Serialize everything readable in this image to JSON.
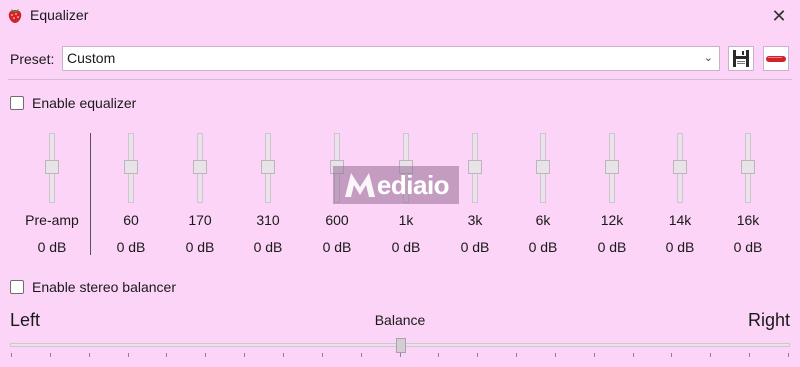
{
  "window": {
    "title": "Equalizer",
    "app_icon": "strawberry-icon",
    "close_icon": "close-icon"
  },
  "preset": {
    "label": "Preset:",
    "selected": "Custom",
    "save_icon": "floppy-disk-icon",
    "delete_icon": "delete-bar-icon"
  },
  "equalizer": {
    "enable_label": "Enable equalizer",
    "enabled": false,
    "bands": [
      {
        "label": "Pre-amp",
        "value": "0 dB",
        "level": 0
      },
      {
        "label": "60",
        "value": "0 dB",
        "level": 0
      },
      {
        "label": "170",
        "value": "0 dB",
        "level": 0
      },
      {
        "label": "310",
        "value": "0 dB",
        "level": 0
      },
      {
        "label": "600",
        "value": "0 dB",
        "level": 0
      },
      {
        "label": "1k",
        "value": "0 dB",
        "level": 0
      },
      {
        "label": "3k",
        "value": "0 dB",
        "level": 0
      },
      {
        "label": "6k",
        "value": "0 dB",
        "level": 0
      },
      {
        "label": "12k",
        "value": "0 dB",
        "level": 0
      },
      {
        "label": "14k",
        "value": "0 dB",
        "level": 0
      },
      {
        "label": "16k",
        "value": "0 dB",
        "level": 0
      }
    ]
  },
  "balancer": {
    "enable_label": "Enable stereo balancer",
    "enabled": false,
    "left_label": "Left",
    "center_label": "Balance",
    "right_label": "Right",
    "value": 0
  },
  "watermark": {
    "text": "ediaio"
  },
  "colors": {
    "background": "#fcd4f7",
    "accent_red": "#d2232a"
  }
}
